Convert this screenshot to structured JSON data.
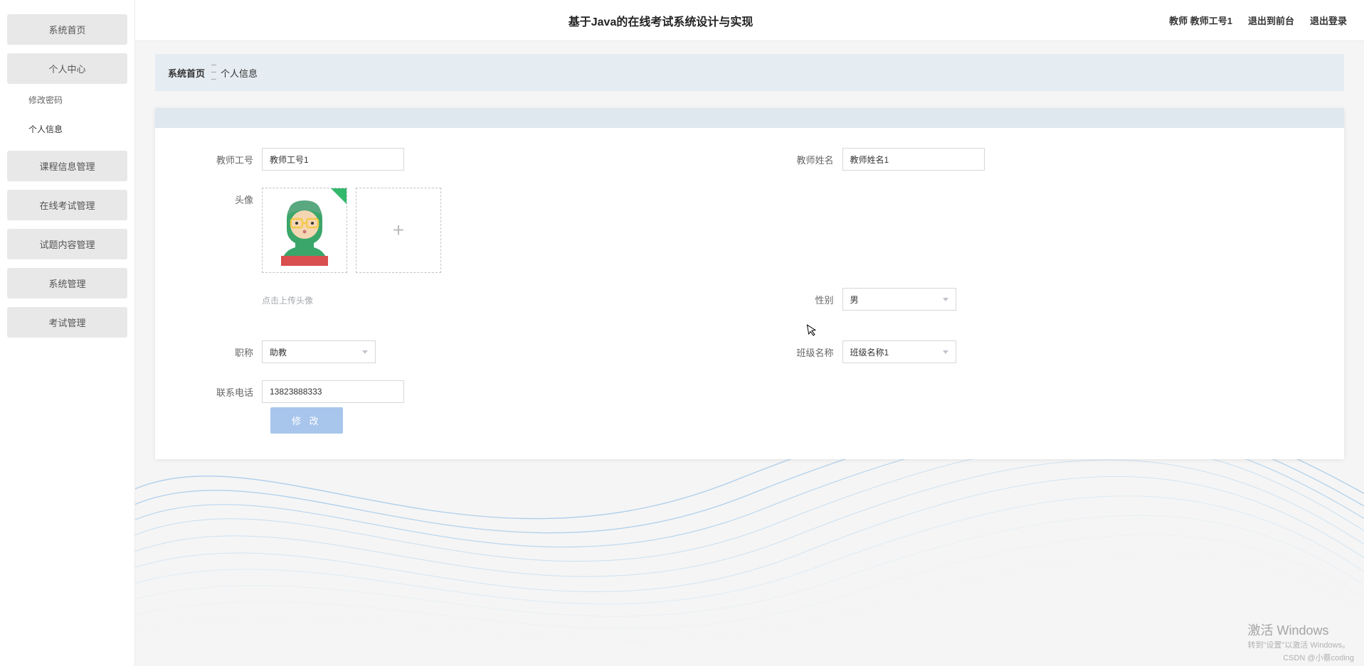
{
  "header": {
    "title": "基于Java的在线考试系统设计与实现",
    "user_role_name": "教师 教师工号1",
    "link_front": "退出到前台",
    "link_logout": "退出登录"
  },
  "sidebar": {
    "items": [
      {
        "label": "系统首页"
      },
      {
        "label": "个人中心"
      },
      {
        "label": "课程信息管理"
      },
      {
        "label": "在线考试管理"
      },
      {
        "label": "试题内容管理"
      },
      {
        "label": "系统管理"
      },
      {
        "label": "考试管理"
      }
    ],
    "sub_items": [
      {
        "label": "修改密码"
      },
      {
        "label": "个人信息"
      }
    ]
  },
  "breadcrumb": {
    "home": "系统首页",
    "current": "个人信息"
  },
  "form": {
    "teacher_id_label": "教师工号",
    "teacher_id_value": "教师工号1",
    "teacher_name_label": "教师姓名",
    "teacher_name_value": "教师姓名1",
    "avatar_label": "头像",
    "upload_hint": "点击上传头像",
    "gender_label": "性别",
    "gender_value": "男",
    "title_label": "职称",
    "title_value": "助教",
    "class_label": "班级名称",
    "class_value": "班级名称1",
    "phone_label": "联系电话",
    "phone_value": "13823888333",
    "submit_label": "修 改"
  },
  "watermark": {
    "line1": "激活 Windows",
    "line2": "转到\"设置\"以激活 Windows。",
    "csdn": "CSDN @小蔡coding"
  }
}
